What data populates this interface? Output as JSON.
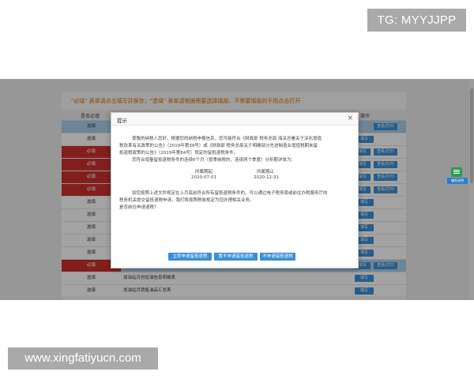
{
  "watermarks": {
    "top": "TG: MYYJJPP",
    "bottom": "www.xingfatiyucn.com"
  },
  "notice": "\"必填\" 表单请点击填写并保存；\"选填\" 表单请根据需要选择填报，不需要填报的不用点击打开",
  "table": {
    "headers": {
      "required": "是否必填",
      "actions": "操作"
    },
    "rows": [
      {
        "req": "选填",
        "must": false,
        "name": "",
        "highlight": true,
        "fill": "",
        "view": "查看/打印"
      },
      {
        "req": "选填",
        "must": false,
        "name": "",
        "highlight": false,
        "fill": "填写",
        "view": ""
      },
      {
        "req": "必填",
        "must": true,
        "name": "",
        "highlight": false,
        "fill": "填写",
        "view": "查看/打印"
      },
      {
        "req": "必填",
        "must": true,
        "name": "",
        "highlight": false,
        "fill": "填写",
        "view": "查看/打印"
      },
      {
        "req": "必填",
        "must": true,
        "name": "",
        "highlight": false,
        "fill": "填写",
        "view": "查看/打印"
      },
      {
        "req": "必填",
        "must": true,
        "name": "",
        "highlight": false,
        "fill": "填写",
        "view": "查看/打印"
      },
      {
        "req": "选填",
        "must": false,
        "name": "",
        "highlight": false,
        "fill": "填写",
        "view": ""
      },
      {
        "req": "选填",
        "must": false,
        "name": "",
        "highlight": false,
        "fill": "填写",
        "view": ""
      },
      {
        "req": "选填",
        "must": false,
        "name": "",
        "highlight": false,
        "fill": "填写",
        "view": ""
      },
      {
        "req": "选填",
        "must": false,
        "name": "",
        "highlight": false,
        "fill": "填写",
        "view": ""
      },
      {
        "req": "选填",
        "must": false,
        "name": "",
        "highlight": false,
        "fill": "填写",
        "view": ""
      },
      {
        "req": "必填",
        "must": true,
        "name": "",
        "highlight": true,
        "fill": "填写",
        "view": "查看/打印"
      },
      {
        "req": "选填",
        "must": false,
        "name": "加油站月份加油信息明细表",
        "highlight": false,
        "fill": "填写",
        "view": ""
      },
      {
        "req": "选填",
        "must": false,
        "name": "加油站月销售油品汇总表",
        "highlight": false,
        "fill": "填写",
        "view": ""
      }
    ]
  },
  "side_widget": {
    "label": "辅条说明"
  },
  "dialog": {
    "title": "提示",
    "close": "×",
    "lines": [
      "尊敬的纳税人您好，根据您的纳税申报信息，您可能符合《财政部 税务总局 海关总署关于深化增值",
      "税改革有关政策的公告》（2019年第39号）或《财政部 税务总局关于明确部分先进制造业增值税期末留",
      "抵退税政策的公告》（2019年第84号）规定的留抵退税条件。",
      "您符合增量留抵退税条件的连续6个月（按季纳税的，连续两个季度）分析期详体为："
    ],
    "period_start_label": "所属期起",
    "period_end_label": "所属期止",
    "period_start": "2020-07-01",
    "period_end": "2020-12-31",
    "lines2": [
      "如您按照上述文件规定在上月底前符合所有留抵退税条件的，可以通过电子税务局或前往办税服务厅向",
      "税务机关提交留抵退税申请，我们将按照税收规定为您办理相关业务。",
      "是否前往申请退税？"
    ],
    "buttons": {
      "apply": "立即申请留抵退税",
      "skip": "暂不申请留抵退税",
      "no_apply": "不申请留抵退税"
    }
  }
}
